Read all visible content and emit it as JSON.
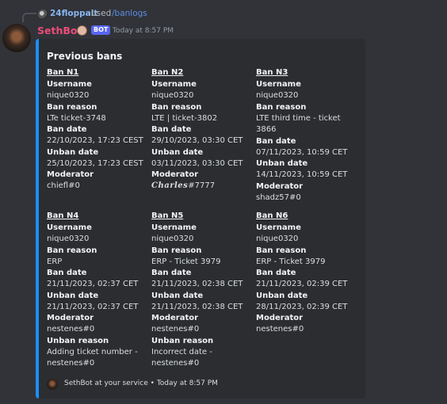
{
  "reply": {
    "user": "24floppalt",
    "used": "used",
    "command": "/banlogs"
  },
  "author": {
    "name": "SethBot",
    "tag": "BOT",
    "timestamp": "Today at 8:57 PM"
  },
  "embed": {
    "title": "Previous bans",
    "accent_color": "#1a8fff",
    "labels": {
      "username": "Username",
      "ban_reason": "Ban reason",
      "ban_date": "Ban date",
      "unban_date": "Unban date",
      "moderator": "Moderator",
      "unban_reason": "Unban reason"
    },
    "bans": [
      {
        "title": "Ban N1",
        "username": "nique0320",
        "ban_reason": "LTe ticket-3748",
        "ban_date": "22/10/2023, 17:23 CEST",
        "unban_date": "25/10/2023, 17:23 CEST",
        "moderator": "chiefl#0",
        "moderator_styled": "",
        "moderator_suffix": "",
        "unban_reason": ""
      },
      {
        "title": "Ban N2",
        "username": "nique0320",
        "ban_reason": "LTE | ticket-3802",
        "ban_date": "29/10/2023, 03:30 CET",
        "unban_date": "03/11/2023, 03:30 CET",
        "moderator": "",
        "moderator_styled": "Charles",
        "moderator_suffix": "#7777",
        "unban_reason": ""
      },
      {
        "title": "Ban N3",
        "username": "nique0320",
        "ban_reason": "LTE third time - ticket 3866",
        "ban_date": "07/11/2023, 10:59 CET",
        "unban_date": "14/11/2023, 10:59 CET",
        "moderator": "shadz57#0",
        "moderator_styled": "",
        "moderator_suffix": "",
        "unban_reason": ""
      },
      {
        "title": "Ban N4",
        "username": "nique0320",
        "ban_reason": "ERP",
        "ban_date": "21/11/2023, 02:37 CET",
        "unban_date": "21/11/2023, 02:37 CET",
        "moderator": "nestenes#0",
        "moderator_styled": "",
        "moderator_suffix": "",
        "unban_reason": "Adding ticket number - nestenes#0"
      },
      {
        "title": "Ban N5",
        "username": "nique0320",
        "ban_reason": "ERP - Ticket 3979",
        "ban_date": "21/11/2023, 02:38 CET",
        "unban_date": "21/11/2023, 02:38 CET",
        "moderator": "nestenes#0",
        "moderator_styled": "",
        "moderator_suffix": "",
        "unban_reason": "Incorrect date - nestenes#0"
      },
      {
        "title": "Ban N6",
        "username": "nique0320",
        "ban_reason": "ERP - Ticket 3979",
        "ban_date": "21/11/2023, 02:39 CET",
        "unban_date": "28/11/2023, 02:39 CET",
        "moderator": "nestenes#0",
        "moderator_styled": "",
        "moderator_suffix": "",
        "unban_reason": ""
      }
    ],
    "footer": "SethBot at your service • Today at 8:57 PM"
  }
}
